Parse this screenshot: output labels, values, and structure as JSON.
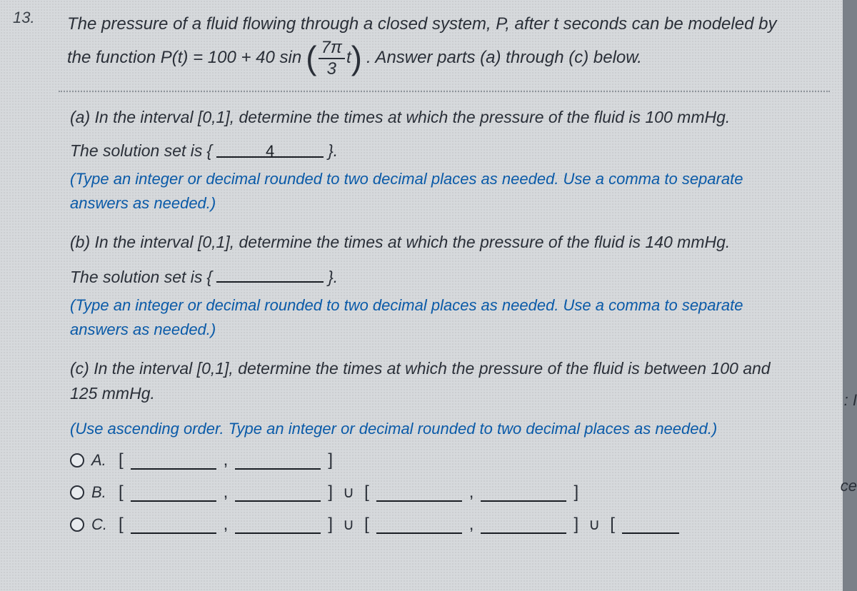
{
  "question_number": "13.",
  "stem_line1": "The pressure of a fluid flowing through a closed system, P, after t seconds can be modeled by",
  "stem_func_prefix": "the function P(t) = 100 + 40 sin",
  "frac_num": "7π",
  "frac_den": "3",
  "frac_t": "t",
  "stem_suffix": ". Answer parts (a) through (c) below.",
  "part_a": {
    "prompt": "(a) In the interval [0,1], determine the times at which the pressure of the fluid is 100 mmHg.",
    "sol_prefix": "The solution set is",
    "brace_open": "{",
    "value": "4",
    "brace_close": "}.",
    "hint": "(Type an integer or decimal rounded to two decimal places as needed. Use a comma to separate answers as needed.)"
  },
  "part_b": {
    "prompt": "(b) In the interval [0,1], determine the times at which the pressure of the fluid is 140 mmHg.",
    "sol_prefix": "The solution set is",
    "brace_open": "{",
    "value": "",
    "brace_close": "}.",
    "hint": "(Type an integer or decimal rounded to two decimal places as needed. Use a comma to separate answers as needed.)"
  },
  "part_c": {
    "prompt": "(c) In the interval [0,1], determine the times at which the pressure of the fluid is between 100 and 125 mmHg.",
    "hint": "(Use ascending order. Type an integer or decimal rounded to two decimal places as needed.)",
    "options": {
      "A": {
        "label": "A.",
        "f1": "",
        "f2": ""
      },
      "B": {
        "label": "B.",
        "f1": "",
        "f2": "",
        "f3": "",
        "f4": ""
      },
      "C": {
        "label": "C.",
        "f1": "",
        "f2": "",
        "f3": "",
        "f4": "",
        "f5": ""
      }
    }
  },
  "glyphs": {
    "lbracket": "[",
    "rbracket": "]",
    "comma": ",",
    "union": "∪"
  },
  "edge": {
    "c1": ": I",
    "c2": "ce"
  }
}
